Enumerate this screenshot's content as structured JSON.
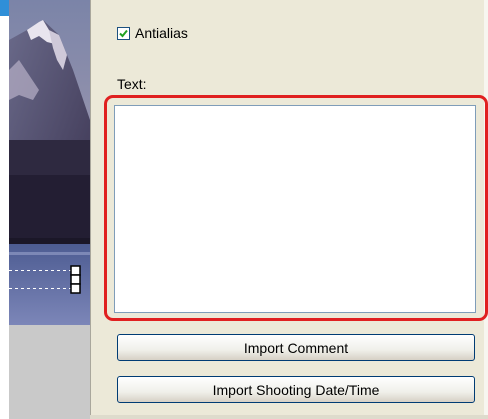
{
  "options": {
    "antialias_label": "Antialias",
    "antialias_checked": true,
    "text_label": "Text:",
    "text_value": ""
  },
  "buttons": {
    "import_comment": "Import Comment",
    "import_shooting_datetime": "Import Shooting Date/Time"
  },
  "colors": {
    "panel_bg": "#ece9d8",
    "highlight_outline": "#e02020",
    "accent": "#2f8fd8"
  }
}
